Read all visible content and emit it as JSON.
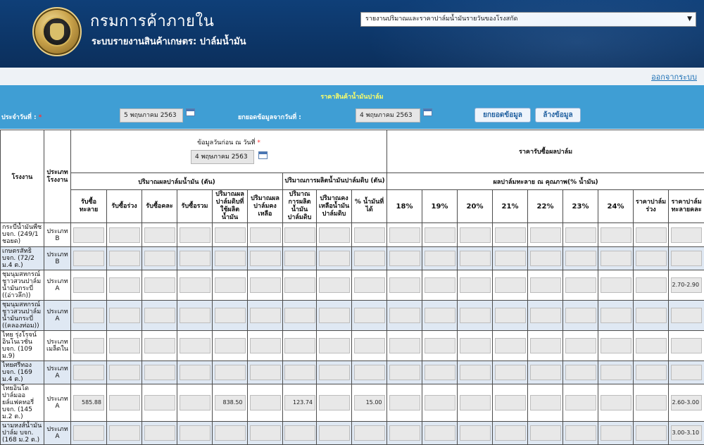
{
  "header": {
    "title": "กรมการค้าภายใน",
    "subtitle": "ระบบรายงานสินค้าเกษตร: ปาล์มน้ำมัน",
    "report_select": "รายงานปริมาณและราคาปาล์มน้ำมันรายวันของโรงสกัด"
  },
  "topbar": {
    "logout": "ออกจากระบบ"
  },
  "form": {
    "title": "ราคาสินค้าน้ำมันปาล์ม",
    "date_label": "ประจำวันที่ :",
    "required_mark": "*",
    "date_value": "5 พฤษภาคม 2563",
    "carry_label": "ยกยอดข้อมูลจากวันที่ :",
    "carry_value": "4 พฤษภาคม 2563",
    "carry_button": "ยกยอดข้อมูล",
    "clear_button": "ล้างข้อมูล"
  },
  "table": {
    "col_factory": "โรงงาน",
    "col_type": "ประเภทโรงงาน",
    "prev_info_label": "ข้อมูลวันก่อน ณ วันที่",
    "prev_info_date": "4 พฤษภาคม 2563",
    "group_fruit": "ปริมาณผลปาล์มน้ำมัน (ตัน)",
    "group_oil": "ปริมาณการผลิตน้ำมันปาล์มดิบ (ตัน)",
    "group_price": "ราคารับซื้อผลปาล์ม",
    "group_quality": "ผลปาล์มทะลาย ณ คุณภาพ(% น้ำมัน)",
    "fruit_cols": [
      "รับซื้อทะลาย",
      "รับซื้อร่วง",
      "รับซื้อคละ",
      "รับซื้อรวม",
      "ปริมาณผลปาล์มดิบที่ใช้ผลิตน้ำมัน",
      "ปริมาณผลปาล์มคงเหลือ"
    ],
    "oil_cols": [
      "ปริมาณการผลิตน้ำมันปาล์มดิบ",
      "ปริมาณคงเหลือน้ำมันปาล์มดิบ",
      "% น้ำมันที่ได้"
    ],
    "quality_cols": [
      "18%",
      "19%",
      "20%",
      "21%",
      "22%",
      "23%",
      "24%"
    ],
    "price_extra_cols": [
      "ราคาปาล์มร่วง",
      "ราคาปาล์มทะลายคละ"
    ],
    "rows": [
      {
        "factory": "กระบี่น้ำมันพืช บจก. (249/1 ชอยด)",
        "type": "ประเภท B",
        "values": [
          "",
          "",
          "",
          "",
          "",
          "",
          "",
          "",
          "",
          "",
          "",
          "",
          "",
          "",
          "",
          "",
          "",
          ""
        ]
      },
      {
        "factory": "เกษตรสัทธิ บจก. (72/2 ม.4 ต.)",
        "type": "ประเภท B",
        "values": [
          "",
          "",
          "",
          "",
          "",
          "",
          "",
          "",
          "",
          "",
          "",
          "",
          "",
          "",
          "",
          "",
          "",
          ""
        ]
      },
      {
        "factory": "ชุมนุมสหกรณ์ชาวสวนปาล์มน้ำมันกระบี่ ((อ่าวลึก))",
        "type": "ประเภท A",
        "values": [
          "",
          "",
          "",
          "",
          "",
          "",
          "",
          "",
          "",
          "",
          "",
          "",
          "",
          "",
          "",
          "",
          "",
          "2.70-2.90"
        ]
      },
      {
        "factory": "ชุมนุมสหกรณ์ชาวสวนปาล์มน้ำมันกระบี่ ((คลองท่อม))",
        "type": "ประเภท A",
        "values": [
          "",
          "",
          "",
          "",
          "",
          "",
          "",
          "",
          "",
          "",
          "",
          "",
          "",
          "",
          "",
          "",
          "",
          ""
        ]
      },
      {
        "factory": "ไทย รุ่งโรจน์ อินโนเวชั่น บจก. (109 ม.9)",
        "type": "ประเภทเมล็ดใน",
        "values": [
          "",
          "",
          "",
          "",
          "",
          "",
          "",
          "",
          "",
          "",
          "",
          "",
          "",
          "",
          "",
          "",
          "",
          ""
        ]
      },
      {
        "factory": "ไทยศรีทอง บจก. (169 ม.4 ต.)",
        "type": "ประเภท A",
        "values": [
          "",
          "",
          "",
          "",
          "",
          "",
          "",
          "",
          "",
          "",
          "",
          "",
          "",
          "",
          "",
          "",
          "",
          ""
        ]
      },
      {
        "factory": "ไทยอินโดปาล์มออยล์แฟคทอรี่ บจก. (145 ม.2 ต.)",
        "type": "ประเภท A",
        "values": [
          "585.88",
          "",
          "",
          "",
          "838.50",
          "",
          "123.74",
          "",
          "15.00",
          "",
          "",
          "",
          "",
          "",
          "",
          "",
          "",
          "2.60-3.00"
        ]
      },
      {
        "factory": "นามหงส์น้ำมันปาล์ม บจก. (168 ม.2 ต.)",
        "type": "ประเภท A",
        "values": [
          "",
          "",
          "",
          "",
          "",
          "",
          "",
          "",
          "",
          "",
          "",
          "",
          "",
          "",
          "",
          "",
          "",
          "3.00-3.10"
        ]
      }
    ]
  }
}
